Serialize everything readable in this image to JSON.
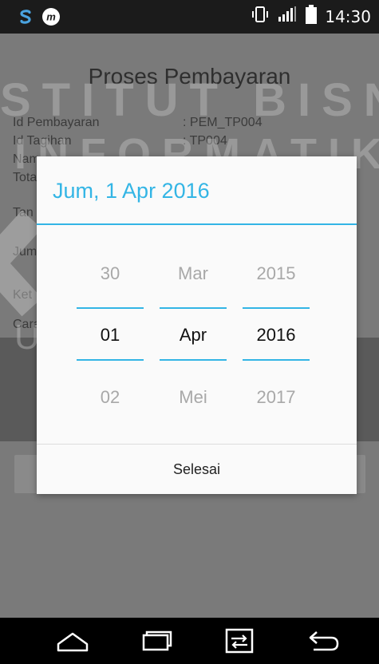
{
  "status_bar": {
    "time": "14:30",
    "icons": [
      "swype-keyboard-icon",
      "messaging-app-icon",
      "vibrate-icon",
      "signal-icon",
      "battery-icon"
    ]
  },
  "app": {
    "title": "Proses Pembayaran",
    "fields": [
      {
        "label": "Id Pembayaran",
        "value": ": PEM_TP004"
      },
      {
        "label": "Id Tagihan",
        "value": ": TP004"
      },
      {
        "label": "Nam",
        "value": ""
      },
      {
        "label": "Tota",
        "value": ""
      },
      {
        "label": "Tan",
        "value": ""
      },
      {
        "label": "Jum",
        "value": ""
      },
      {
        "label": "Ket",
        "value": ""
      },
      {
        "label": "Cara",
        "value": ""
      }
    ]
  },
  "watermark": {
    "line1": "STITUT BISNIS",
    "line2": "INFORMATIKA",
    "line3": "URABAYA"
  },
  "dialog": {
    "selected_date": "Jum, 1 Apr 2016",
    "day": {
      "prev": "30",
      "current": "01",
      "next": "02"
    },
    "month": {
      "prev": "Mar",
      "current": "Apr",
      "next": "Mei"
    },
    "year": {
      "prev": "2015",
      "current": "2016",
      "next": "2017"
    },
    "done_label": "Selesai"
  },
  "nav_bar": {
    "buttons": [
      "home-icon",
      "recent-apps-icon",
      "dual-window-icon",
      "back-icon"
    ]
  },
  "colors": {
    "accent": "#33b5e5",
    "dialog_bg": "#fafafa",
    "overlay": "#7a7a7a"
  }
}
